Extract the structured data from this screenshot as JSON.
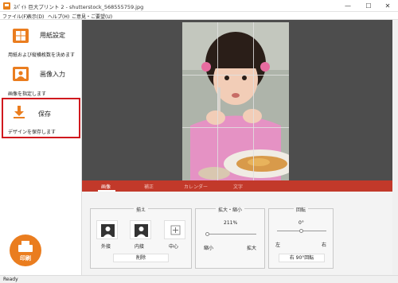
{
  "window": {
    "title": "ｽﾊﾟｲﾄ 巨大プリント 2 - shutterstock_568555759.jpg",
    "minimize": "—",
    "maximize": "☐",
    "close": "✕"
  },
  "menu": [
    "ファイル(F)",
    "表示(D)",
    "ヘルプ(H)",
    "ご意見・ご要望(U)"
  ],
  "sidebar": {
    "paper": {
      "label": "用紙設定",
      "desc": "用紙および縦横枚数を決めます",
      "icon": "paper-icon"
    },
    "image": {
      "label": "画像入力",
      "desc": "画像を指定します",
      "icon": "portrait-icon"
    },
    "save": {
      "label": "保存",
      "desc": "デザインを保存します",
      "icon": "download-arrow-icon"
    },
    "print": {
      "label": "印刷",
      "icon": "printer-icon"
    }
  },
  "tabs": [
    {
      "label": "画像",
      "active": true
    },
    {
      "label": "補正",
      "active": false
    },
    {
      "label": "カレンダー",
      "active": false
    },
    {
      "label": "文字",
      "active": false
    }
  ],
  "fit": {
    "title": "揃え",
    "outer": "外接",
    "inner": "内接",
    "center": "中心",
    "delete": "削除"
  },
  "zoom": {
    "title": "拡大・縮小",
    "value": "211%",
    "min": "縮小",
    "max": "拡大",
    "level": 0.05
  },
  "rotate": {
    "title": "回転",
    "value": "0°",
    "left": "左",
    "right": "右",
    "rotate90": "右 90°回転",
    "level": 0.5
  },
  "status": "Ready",
  "colors": {
    "accent": "#ea7d1f",
    "tabbar": "#c2392a",
    "selection": "#d0191e",
    "preview_bg": "#4d4d4d"
  }
}
